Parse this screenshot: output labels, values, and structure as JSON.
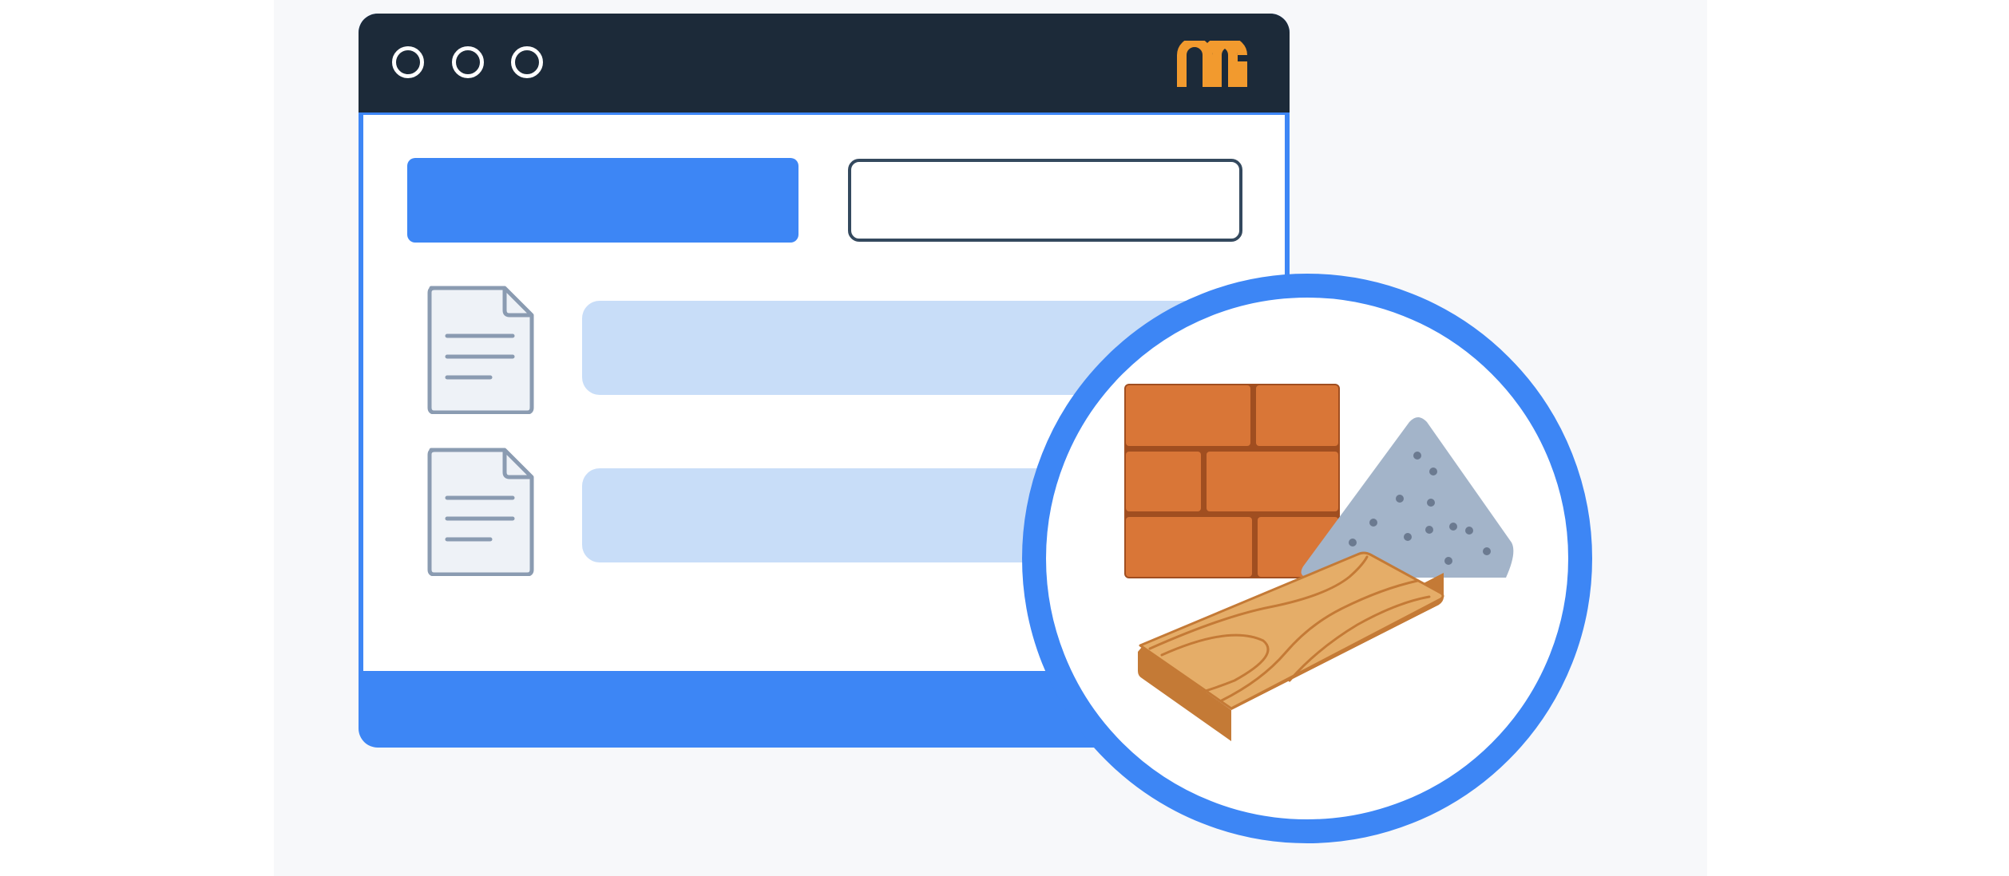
{
  "colors": {
    "titlebar": "#1c2a39",
    "accent_blue": "#3d86f5",
    "light_blue_bar": "#c8ddf8",
    "input_border": "#34495e",
    "logo_orange": "#f29a2e",
    "brick": "#d97637",
    "sand": "#a3b4c9",
    "wood": "#e5ad68"
  },
  "window": {
    "controls": [
      "window-control-dot",
      "window-control-dot",
      "window-control-dot"
    ],
    "logo_icon": "m-logo-icon"
  },
  "toolbar": {
    "primary_button_label": "",
    "search_input_value": "",
    "search_input_placeholder": ""
  },
  "rows": [
    {
      "icon": "document-icon",
      "label": ""
    },
    {
      "icon": "document-icon",
      "label": ""
    }
  ],
  "badge": {
    "icons": [
      "brick-wall-icon",
      "sand-pile-icon",
      "wood-plank-icon"
    ]
  }
}
